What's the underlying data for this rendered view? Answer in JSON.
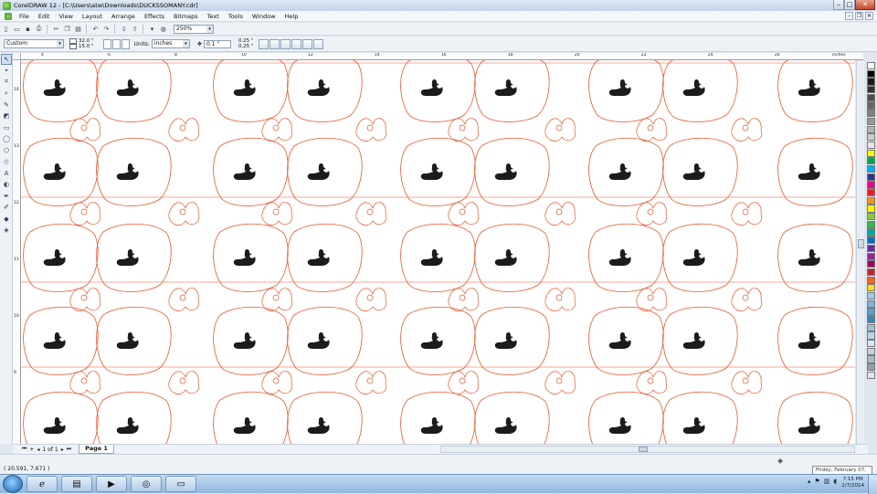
{
  "window": {
    "title": "CorelDRAW 12 - [C:\\Users\\atw\\Downloads\\DUCKSSOMANY.cdr]"
  },
  "menu": [
    {
      "label": "File"
    },
    {
      "label": "Edit"
    },
    {
      "label": "View"
    },
    {
      "label": "Layout"
    },
    {
      "label": "Arrange"
    },
    {
      "label": "Effects"
    },
    {
      "label": "Bitmaps"
    },
    {
      "label": "Text"
    },
    {
      "label": "Tools"
    },
    {
      "label": "Window"
    },
    {
      "label": "Help"
    }
  ],
  "toolbar": {
    "zoom": "250%"
  },
  "property_bar": {
    "paper_preset": "Custom",
    "width": "32.0 \"",
    "height": "15.0 \"",
    "units_label": "Units:",
    "units": "inches",
    "nudge": "0.1 \"",
    "dup_h": "0.25 \"",
    "dup_v": "0.25 \""
  },
  "ruler": {
    "h_numbers": [
      "4",
      "6",
      "8",
      "10",
      "12",
      "14",
      "16",
      "18",
      "20",
      "22",
      "24",
      "26"
    ],
    "h_unit": "inches",
    "v_numbers": [
      "14",
      "13",
      "12",
      "11",
      "10",
      "9"
    ]
  },
  "pages": {
    "current": "1",
    "count_text": "1 of 1",
    "tab": "Page 1"
  },
  "status": {
    "coords": "( 20.591, 7.671 )"
  },
  "taskbar": {
    "time": "7:15 PM",
    "date": "2/7/2014",
    "tooltip": "Friday, February 07, 2014"
  },
  "palette": [
    "#ffffff",
    "#000000",
    "#1a1a1a",
    "#333333",
    "#4d4d4d",
    "#666666",
    "#808080",
    "#999999",
    "#b3b3b3",
    "#cccccc",
    "#e6e6e6",
    "#ffff00",
    "#00a651",
    "#00aeef",
    "#2e3192",
    "#ec008c",
    "#ed1c24",
    "#f7941d",
    "#fff200",
    "#8dc63f",
    "#39b54a",
    "#00a99d",
    "#0072bc",
    "#662d91",
    "#92278f",
    "#9e005d",
    "#c1272d",
    "#f26522",
    "#ffde17",
    "#a0c8e0",
    "#7fb2d6",
    "#5c9ccc",
    "#3a86be",
    "#9ec1d6",
    "#bcd4e4",
    "#d8e6f0",
    "#c8d3db",
    "#a9b7c2",
    "#8fa1b0",
    "#dfe6ee"
  ],
  "canvas": {
    "duck_color": "#1c1c1c",
    "outline_color": "#e8552a"
  }
}
